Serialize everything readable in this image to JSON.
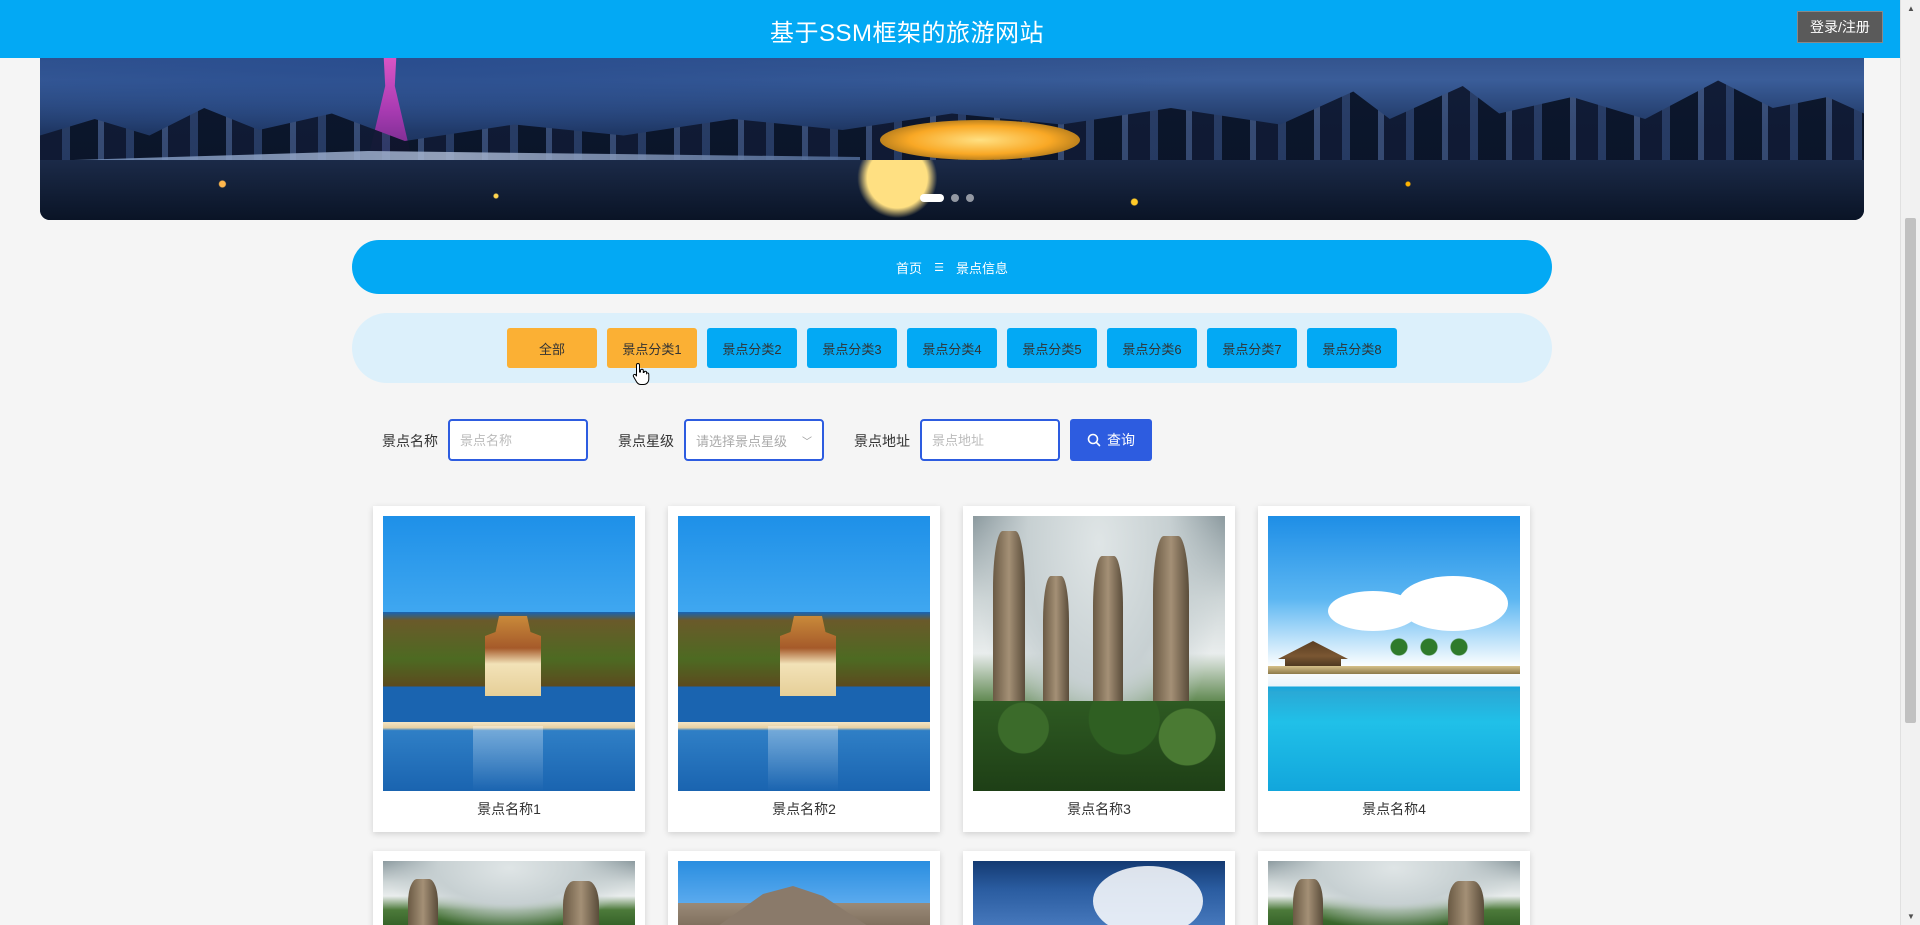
{
  "header": {
    "title": "基于SSM框架的旅游网站",
    "login_label": "登录/注册"
  },
  "banner": {
    "slide_count": 3,
    "active_slide": 0
  },
  "breadcrumb": {
    "home": "首页",
    "separator": "☰",
    "current": "景点信息"
  },
  "categories": [
    {
      "label": "全部",
      "state": "active"
    },
    {
      "label": "景点分类1",
      "state": "hover"
    },
    {
      "label": "景点分类2",
      "state": "normal"
    },
    {
      "label": "景点分类3",
      "state": "normal"
    },
    {
      "label": "景点分类4",
      "state": "normal"
    },
    {
      "label": "景点分类5",
      "state": "normal"
    },
    {
      "label": "景点分类6",
      "state": "normal"
    },
    {
      "label": "景点分类7",
      "state": "normal"
    },
    {
      "label": "景点分类8",
      "state": "normal"
    }
  ],
  "search": {
    "name_label": "景点名称",
    "name_placeholder": "景点名称",
    "rating_label": "景点星级",
    "rating_placeholder": "请选择景点星级",
    "address_label": "景点地址",
    "address_placeholder": "景点地址",
    "query_label": "查询"
  },
  "cards": [
    {
      "name": "景点名称1",
      "image": "palace"
    },
    {
      "name": "景点名称2",
      "image": "palace"
    },
    {
      "name": "景点名称3",
      "image": "peaks"
    },
    {
      "name": "景点名称4",
      "image": "resort"
    }
  ],
  "cards_row2": [
    {
      "image": "peaks"
    },
    {
      "image": "mountain"
    },
    {
      "image": "sky"
    },
    {
      "image": "peaks"
    }
  ],
  "colors": {
    "primary": "#03a9f4",
    "accent": "#fbb034",
    "search_blue": "#2d5ce0",
    "background": "#f5f5f5"
  }
}
